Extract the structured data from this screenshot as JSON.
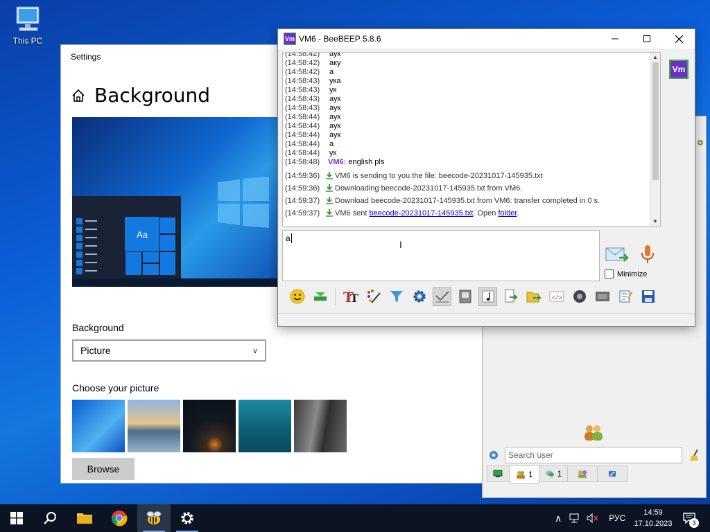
{
  "desktop": {
    "icons": [
      {
        "label": "This PC",
        "icon": "this-pc-icon"
      }
    ]
  },
  "settings": {
    "window_title": "Settings",
    "page_title": "Background",
    "preview_tile_label": "Aa",
    "background_label": "Background",
    "background_selected": "Picture",
    "choose_label": "Choose your picture",
    "browse_label": "Browse"
  },
  "userpanel": {
    "search_placeholder": "Search user",
    "tabs": [
      {
        "icon": "users-icon",
        "count": "1"
      },
      {
        "icon": "chat-bubbles-icon",
        "count": "1"
      },
      {
        "icon": "groups-icon",
        "count": ""
      },
      {
        "icon": "file-share-icon",
        "count": ""
      }
    ]
  },
  "chat": {
    "window_title": "VM6 - BeeBEEP 5.8.6",
    "app_icon_text": "Vm",
    "avatar_text": "Vm",
    "messages": [
      {
        "time": "(14:58:42)",
        "text": "аук"
      },
      {
        "time": "(14:58:42)",
        "text": "аку"
      },
      {
        "time": "(14:58:42)",
        "text": "а"
      },
      {
        "time": "(14:58:43)",
        "text": "ука"
      },
      {
        "time": "(14:58:43)",
        "text": "ук"
      },
      {
        "time": "(14:58:43)",
        "text": "аук"
      },
      {
        "time": "(14:58:43)",
        "text": "аук"
      },
      {
        "time": "(14:58:44)",
        "text": "аук"
      },
      {
        "time": "(14:58:44)",
        "text": "аук"
      },
      {
        "time": "(14:58:44)",
        "text": "аук"
      },
      {
        "time": "(14:58:44)",
        "text": "а"
      },
      {
        "time": "(14:58:44)",
        "text": "ук"
      }
    ],
    "last_message": {
      "time": "(14:58:48)",
      "sender": "VM6:",
      "text": "english pls"
    },
    "system_lines": [
      {
        "time": "(14:59:36)",
        "text": "VM6 is sending to you the file: beecode-20231017-145935.txt"
      },
      {
        "time": "(14:59:36)",
        "text": "Downloading beecode-20231017-145935.txt from VM6."
      },
      {
        "time": "(14:59:37)",
        "text": "Download beecode-20231017-145935.txt from VM6: transfer completed in 0 s."
      }
    ],
    "sent_line": {
      "time": "(14:59:37)",
      "prefix": "VM6 sent",
      "file_link": "beecode-20231017-145935.txt",
      "middle": ". Open",
      "folder_link": "folder",
      "suffix": "."
    },
    "input_value": "a",
    "minimize_label": "Minimize",
    "minimize_checked": false
  },
  "taskbar": {
    "apps": [
      "start-icon",
      "search-icon",
      "file-explorer-icon",
      "chrome-icon",
      "beebeep-icon",
      "settings-gear-icon"
    ],
    "language": "РУС",
    "time": "14:59",
    "date": "17.10.2023",
    "notifications": "3"
  },
  "colors": {
    "accent": "#0078d7",
    "sender": "#7b2fcf",
    "link": "#0000cc",
    "taskbar": "#0c1424"
  }
}
